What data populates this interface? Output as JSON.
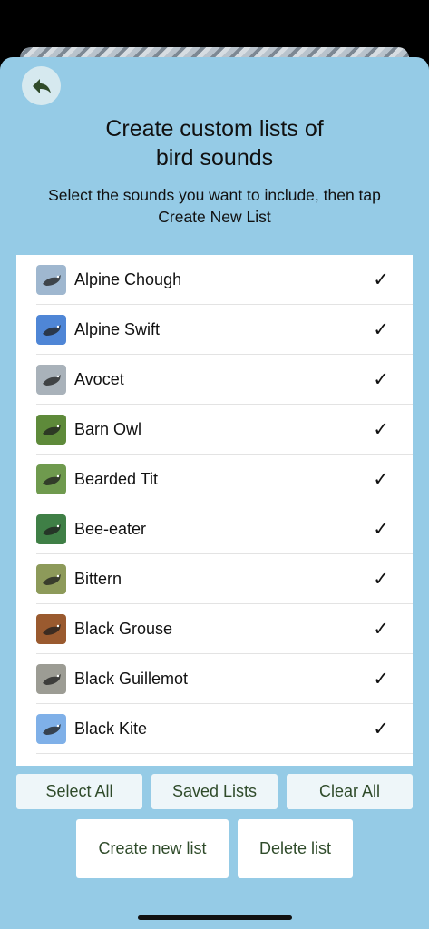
{
  "header": {
    "back_icon": "back-arrow-icon",
    "title": "Create custom lists of\nbird sounds",
    "subtitle": "Select the sounds you want to include, then tap\nCreate New List"
  },
  "colors": {
    "sheet_background": "#95cbe6",
    "list_background": "#ffffff",
    "button_text": "#2f4b2a",
    "button_background": "#eef6f9"
  },
  "birds": [
    {
      "name": "Alpine Chough",
      "checked": true,
      "check_mark": "✓",
      "thumb_bg": "#9fb7cf",
      "thumb_icon": "bird-photo-icon"
    },
    {
      "name": "Alpine Swift",
      "checked": true,
      "check_mark": "✓",
      "thumb_bg": "#4f86d6",
      "thumb_icon": "bird-photo-icon"
    },
    {
      "name": "Avocet",
      "checked": true,
      "check_mark": "✓",
      "thumb_bg": "#a9b2ba",
      "thumb_icon": "bird-photo-icon"
    },
    {
      "name": "Barn Owl",
      "checked": true,
      "check_mark": "✓",
      "thumb_bg": "#5e8a3a",
      "thumb_icon": "bird-photo-icon"
    },
    {
      "name": "Bearded Tit",
      "checked": true,
      "check_mark": "✓",
      "thumb_bg": "#6f9a4e",
      "thumb_icon": "bird-photo-icon"
    },
    {
      "name": "Bee-eater",
      "checked": true,
      "check_mark": "✓",
      "thumb_bg": "#3f7f46",
      "thumb_icon": "bird-photo-icon"
    },
    {
      "name": "Bittern",
      "checked": true,
      "check_mark": "✓",
      "thumb_bg": "#8d9a5a",
      "thumb_icon": "bird-photo-icon"
    },
    {
      "name": "Black Grouse",
      "checked": true,
      "check_mark": "✓",
      "thumb_bg": "#9a5a2f",
      "thumb_icon": "bird-photo-icon"
    },
    {
      "name": "Black Guillemot",
      "checked": true,
      "check_mark": "✓",
      "thumb_bg": "#9c9c94",
      "thumb_icon": "bird-photo-icon"
    },
    {
      "name": "Black Kite",
      "checked": true,
      "check_mark": "✓",
      "thumb_bg": "#7fb0e8",
      "thumb_icon": "bird-photo-icon"
    }
  ],
  "actions": {
    "select_all": "Select All",
    "saved_lists": "Saved Lists",
    "clear_all": "Clear All",
    "create_new_list": "Create new list",
    "delete_list": "Delete list"
  }
}
